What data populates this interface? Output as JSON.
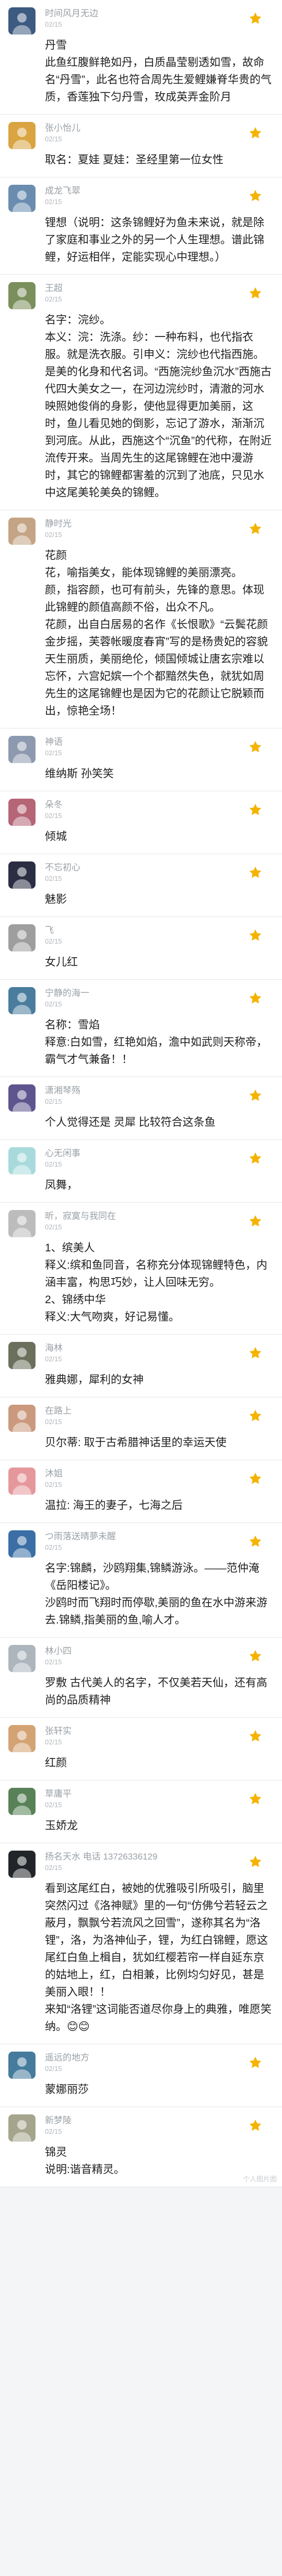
{
  "comments": [
    {
      "username": "时间风月无边",
      "date": "02/15",
      "text": "丹雪\n此鱼红腹鲜艳如丹，白质晶莹剔透如雪，故命名“丹雪”，此名也符合周先生爱鲤嫌脊华贵的气质，香莲独下匀丹雪，玫成英弄金阶月",
      "avatar_color": "#3d5a80",
      "liked": true,
      "icon": "star-icon"
    },
    {
      "username": "张小怡儿",
      "date": "02/15",
      "text": "取名：夏娃 夏娃：圣经里第一位女性",
      "avatar_color": "#d9a441",
      "liked": false,
      "icon": "star-icon"
    },
    {
      "username": "成龙飞翠",
      "date": "02/15",
      "text": "锂想（说明：这条锦鲤好为鱼未来说，就是除了家庭和事业之外的另一个人生理想。谱此锦鲤，好运相伴，定能实现心中理想。）",
      "avatar_color": "#6a8caf",
      "liked": true,
      "icon": "star-icon"
    },
    {
      "username": "王超",
      "date": "02/15",
      "text": "名字：浣纱。\n本义：浣：洗涤。纱：一种布料，也代指衣服。就是洗衣服。引申义：浣纱也代指西施。是美的化身和代名词。“西施浣纱鱼沉水”西施古代四大美女之一，在河边浣纱时，清澈的河水映照她俊俏的身影，使他显得更加美丽，这时，鱼儿看见她的倒影，忘记了游水，渐渐沉到河底。从此，西施这个“沉鱼”的代称，在附近流传开来。当周先生的这尾锦鲤在池中漫游时，其它的锦鲤都害羞的沉到了池底，只见水中这尾美轮美奂的锦鲤。",
      "avatar_color": "#7a8f5c",
      "liked": true,
      "icon": "star-icon"
    },
    {
      "username": "静时光",
      "date": "02/15",
      "text": "花颜\n花，喻指美女，能体现锦鲤的美丽漂亮。\n颜，指容颜，也可有前头，先锋的意思。体现此锦鲤的颜值高颜不俗，出众不凡。\n花颜，出自白居易的名作《长恨歌》“云鬓花颜金步摇，芙蓉帐暖度春宵”写的是杨贵妃的容貌天生丽质，美丽绝伦，倾国倾城让唐玄宗难以忘怀，六宫妃嫔一个个都黯然失色，就犹如周先生的这尾锦鲤也是因为它的花颜让它脱颖而出，惊艳全场！",
      "avatar_color": "#c4a484",
      "liked": true,
      "icon": "star-icon"
    },
    {
      "username": "神语",
      "date": "02/15",
      "text": "维纳斯 孙笑笑",
      "avatar_color": "#8d99ae",
      "liked": false,
      "icon": "star-icon"
    },
    {
      "username": "朵冬",
      "date": "02/15",
      "text": "倾城",
      "avatar_color": "#b56576",
      "liked": false,
      "icon": "star-icon"
    },
    {
      "username": "不忘初心",
      "date": "02/15",
      "text": "魅影",
      "avatar_color": "#2b2d42",
      "liked": false,
      "icon": "star-icon"
    },
    {
      "username": "飞",
      "date": "02/15",
      "text": "女儿红",
      "avatar_color": "#9e9e9e",
      "liked": false,
      "icon": "star-icon"
    },
    {
      "username": "宁静的海一",
      "date": "02/15",
      "text": "名称：雪焰\n释意:白如雪，红艳如焰，澹中如武则天称帝，霸气才气兼备！！",
      "avatar_color": "#4a7c9d",
      "liked": false,
      "icon": "star-icon"
    },
    {
      "username": "潇湘琴殇",
      "date": "02/15",
      "text": "个人觉得还是 灵犀 比较符合这条鱼",
      "avatar_color": "#5e548e",
      "liked": false,
      "icon": "star-icon"
    },
    {
      "username": "心无闲事",
      "date": "02/15",
      "text": "凤舞，",
      "avatar_color": "#a8dadc",
      "liked": false,
      "icon": "star-icon"
    },
    {
      "username": "昕，寂寞与我同在",
      "date": "02/15",
      "text": "1、缤美人\n释义:缤和鱼同音，名称充分体现锦鲤特色，内涵丰富，构思巧妙，让人回味无穷。\n2、锦绣中华\n释义:大气吻爽，好记易懂。",
      "avatar_color": "#bcbcbc",
      "liked": false,
      "icon": "star-icon"
    },
    {
      "username": "海林",
      "date": "02/15",
      "text": "雅典娜，犀利的女神",
      "avatar_color": "#6b705c",
      "liked": false,
      "icon": "star-icon"
    },
    {
      "username": "在路上",
      "date": "02/15",
      "text": "贝尔蒂: 取于古希腊神话里的幸运天使",
      "avatar_color": "#cb997e",
      "liked": false,
      "icon": "star-icon"
    },
    {
      "username": "沐姐",
      "date": "02/15",
      "text": "温拉: 海王的妻子，七海之后",
      "avatar_color": "#e5989b",
      "liked": false,
      "icon": "star-icon"
    },
    {
      "username": "つ雨落送晴夢未醒",
      "date": "02/15",
      "text": "名字:锦麟，沙鸥翔集,锦鳞游泳。——范仲淹《岳阳楼记》。\n沙鸥时而飞翔时而停歇,美丽的鱼在水中游来游去.锦鳞,指美丽的鱼,喻人才。",
      "avatar_color": "#3a6ea5",
      "liked": false,
      "icon": "star-icon"
    },
    {
      "username": "林小四",
      "date": "02/15",
      "text": "罗敷 古代美人的名字，不仅美若天仙，还有高尚的品质精神",
      "avatar_color": "#adb5bd",
      "liked": false,
      "icon": "star-icon"
    },
    {
      "username": "张轩实",
      "date": "02/15",
      "text": "红颜",
      "avatar_color": "#d4a373",
      "liked": false,
      "icon": "star-icon"
    },
    {
      "username": "草庸平",
      "date": "02/15",
      "text": "玉娇龙",
      "avatar_color": "#588157",
      "liked": false,
      "icon": "star-icon"
    },
    {
      "username": "扬名天水 电话 13726336129",
      "date": "02/15",
      "text": "看到这尾红白，被她的优雅吸引所吸引，脑里突然闪过《洛神赋》里的一句“仿佛兮若轻云之蔽月，飘飘兮若流风之回雪”，遂称其名为“洛锂”，洛，为洛神仙子，锂，为红白锦鲤，愿这尾红白鱼上楫自，犹如红樱若帘一样自延东京的姑地上，红，白相兼，比例均匀好见，甚是美丽入眼！！\n来知“洛锂”这词能否道尽你身上的典雅，唯愿笑纳。😊😊",
      "avatar_color": "#212529",
      "liked": false,
      "icon": "star-icon"
    },
    {
      "username": "遥远的地方",
      "date": "02/15",
      "text": "蒙娜丽莎",
      "avatar_color": "#457b9d",
      "liked": false,
      "icon": "star-icon"
    },
    {
      "username": "新梦陵",
      "date": "02/15",
      "text": "锦灵\n说明:谐音精灵。",
      "avatar_color": "#a5a58d",
      "liked": false,
      "icon": "star-icon"
    }
  ],
  "footer": {
    "watermark": "个人图片图"
  },
  "colors": {
    "star_liked": "#f5b301",
    "star_unliked": "#f5b301",
    "username": "#9aa0a6"
  }
}
